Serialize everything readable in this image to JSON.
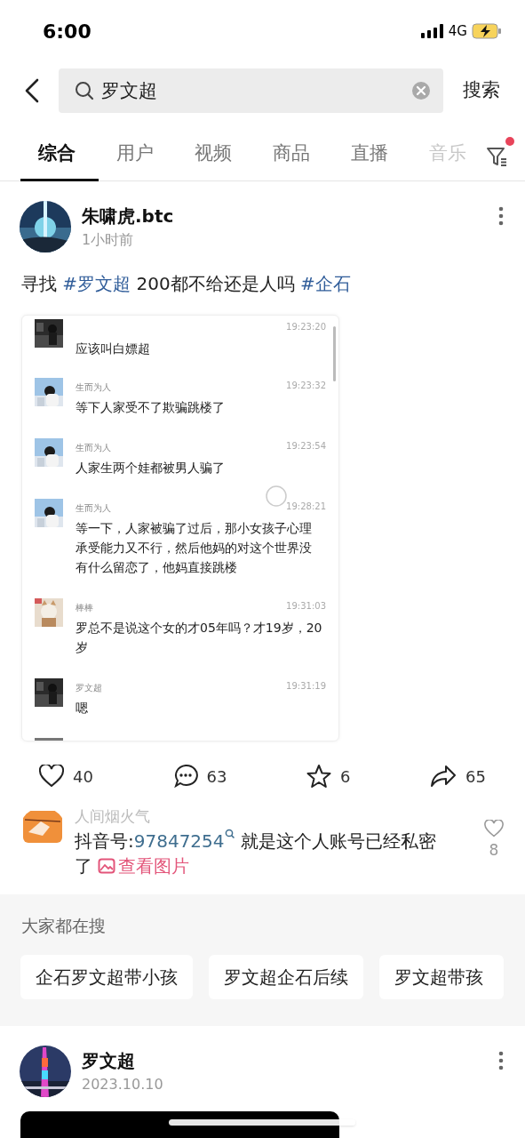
{
  "status_bar": {
    "time": "6:00",
    "network": "4G"
  },
  "search": {
    "value": "罗文超",
    "button": "搜索"
  },
  "tabs": [
    {
      "label": "综合",
      "selected": true
    },
    {
      "label": "用户",
      "selected": false
    },
    {
      "label": "视频",
      "selected": false
    },
    {
      "label": "商品",
      "selected": false
    },
    {
      "label": "直播",
      "selected": false
    },
    {
      "label": "音乐",
      "selected": false
    }
  ],
  "filter": {
    "has_dot": true
  },
  "post": {
    "author": "朱啸虎.btc",
    "time": "1小时前",
    "text": [
      {
        "kind": "plain",
        "text": "寻找 "
      },
      {
        "kind": "hashtag",
        "text": "#罗文超"
      },
      {
        "kind": "plain",
        "text": " 200都不给还是人吗 "
      },
      {
        "kind": "hashtag",
        "text": "#企石"
      }
    ],
    "chat": [
      {
        "time": "19:23:20",
        "text": "应该叫白嫖超"
      },
      {
        "name": "生而为人",
        "time": "19:23:32",
        "text": "等下人家受不了欺骗跳楼了"
      },
      {
        "name": "生而为人",
        "time": "19:23:54",
        "text": "人家生两个娃都被男人骗了"
      },
      {
        "name": "生而为人",
        "time": "19:28:21",
        "text": "等一下，人家被骗了过后，那小女孩子心理承受能力又不行，然后他妈的对这个世界没有什么留恋了，他妈直接跳楼"
      },
      {
        "name": "棒棒",
        "time": "19:31:03",
        "text": "罗总不是说这个女的才05年吗？才19岁，20岁"
      },
      {
        "name": "罗文超",
        "time": "19:31:19",
        "text": "嗯"
      }
    ],
    "actions": [
      {
        "kind": "like",
        "count": "40"
      },
      {
        "kind": "comment",
        "count": "63"
      },
      {
        "kind": "star",
        "count": "6"
      },
      {
        "kind": "share",
        "count": "65"
      }
    ],
    "comment": {
      "author": "人间烟火气",
      "parts": [
        {
          "kind": "plain",
          "text": "抖音号:"
        },
        {
          "kind": "id",
          "text": "97847254"
        },
        {
          "kind": "plain",
          "text": " 就是这个人账号已经私密了 "
        },
        {
          "kind": "image_link",
          "text": "查看图片"
        }
      ],
      "likes": "8"
    }
  },
  "trending": {
    "title": "大家都在搜",
    "chips": [
      "企石罗文超带小孩",
      "罗文超企石后续",
      "罗文超带孩"
    ]
  },
  "post2": {
    "author": "罗文超",
    "time": "2023.10.10"
  }
}
